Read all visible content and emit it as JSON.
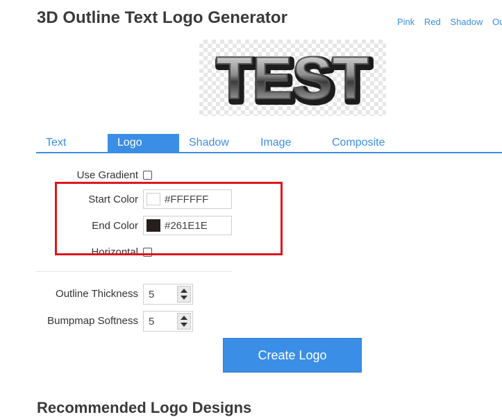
{
  "page": {
    "title": "3D Outline Text Logo Generator",
    "style_links": [
      "Pink",
      "Red",
      "Shadow",
      "Out"
    ],
    "preview_text": "TEST"
  },
  "tabs": [
    {
      "label": "Text",
      "active": false
    },
    {
      "label": "Logo",
      "active": true
    },
    {
      "label": "Shadow",
      "active": false
    },
    {
      "label": "Image",
      "active": false
    },
    {
      "label": "Composite",
      "active": false
    }
  ],
  "form": {
    "use_gradient": {
      "label": "Use Gradient",
      "checked": false
    },
    "start_color": {
      "label": "Start Color",
      "value": "#FFFFFF",
      "swatch": "#FFFFFF"
    },
    "end_color": {
      "label": "End Color",
      "value": "#261E1E",
      "swatch": "#261E1E"
    },
    "horizontal": {
      "label": "Horizontal",
      "checked": false
    },
    "outline_thickness": {
      "label": "Outline Thickness",
      "value": "5"
    },
    "bumpmap_softness": {
      "label": "Bumpmap Softness",
      "value": "5"
    }
  },
  "create_button": "Create Logo",
  "recommended_heading": "Recommended Logo Designs",
  "colors": {
    "accent": "#3a8ee6",
    "highlight": "#e0141b"
  }
}
